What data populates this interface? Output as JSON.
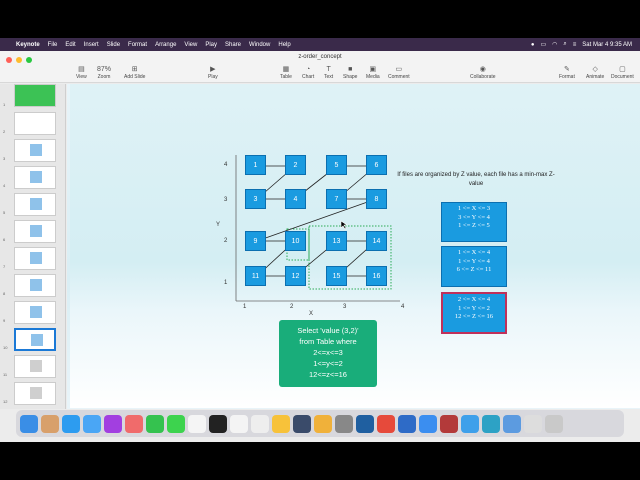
{
  "menubar": {
    "app": "Keynote",
    "items": [
      "File",
      "Edit",
      "Insert",
      "Slide",
      "Format",
      "Arrange",
      "View",
      "Play",
      "Share",
      "Window",
      "Help"
    ],
    "clock": "Sat Mar 4  9:35 AM"
  },
  "window": {
    "title": "z-order_concept"
  },
  "toolbar": {
    "view": "View",
    "zoom_value": "87%",
    "zoom": "Zoom",
    "add_slide": "Add Slide",
    "play": "Play",
    "table": "Table",
    "chart": "Chart",
    "text": "Text",
    "shape": "Shape",
    "media": "Media",
    "comment": "Comment",
    "collaborate": "Collaborate",
    "format": "Format",
    "animate": "Animate",
    "document": "Document"
  },
  "sidebar": {
    "slide_numbers": [
      "1",
      "2",
      "3",
      "4",
      "5",
      "6",
      "7",
      "8",
      "9",
      "10",
      "11",
      "12"
    ],
    "selected": "10"
  },
  "slide": {
    "grid_cells": [
      "1",
      "2",
      "5",
      "6",
      "3",
      "4",
      "7",
      "8",
      "9",
      "10",
      "13",
      "14",
      "11",
      "12",
      "15",
      "16"
    ],
    "y_axis_title": "Y",
    "x_axis_title": "X",
    "y_ticks": [
      "4",
      "3",
      "2",
      "1"
    ],
    "x_ticks": [
      "1",
      "2",
      "3",
      "4"
    ],
    "info_text": "If files are organized by Z value, each file has a min-max Z-value",
    "ranges": [
      {
        "l1": "1 <= X <= 3",
        "l2": "3 <= Y <= 4",
        "l3": "1 <= Z <= 5"
      },
      {
        "l1": "1 <= X <= 4",
        "l2": "1 <= Y <= 4",
        "l3": "6 <= Z <= 11"
      },
      {
        "l1": "2 <= X <= 4",
        "l2": "1 <= Y <= 2",
        "l3": "12 <= Z <= 16"
      }
    ],
    "query": {
      "l1": "Select 'value (3,2)'",
      "l2": "from Table where",
      "l3": "2<=x<=3",
      "l4": "1<=y<=2",
      "l5": "12<=z<=16"
    }
  }
}
